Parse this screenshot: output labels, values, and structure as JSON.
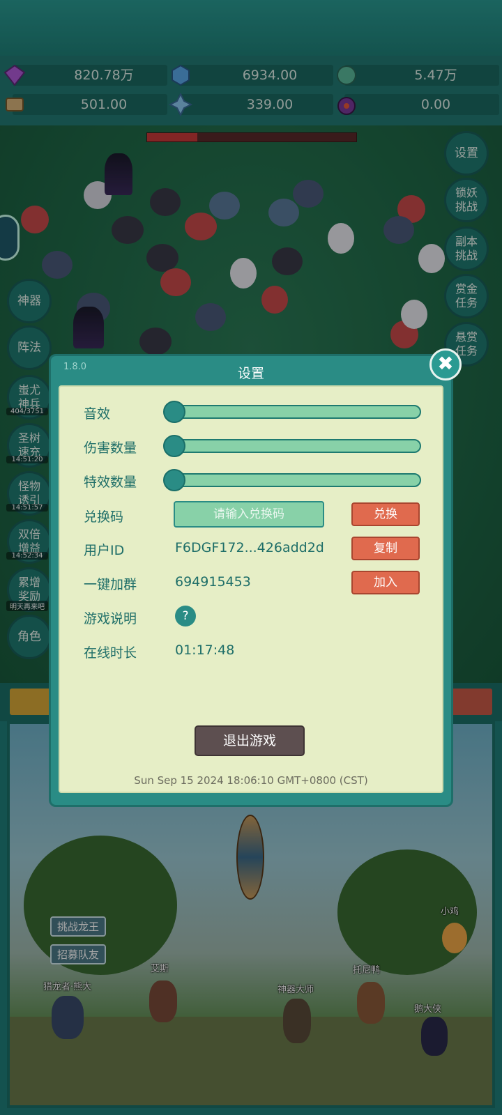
{
  "resources": [
    {
      "icon": "purple-gem-icon",
      "value": "820.78万"
    },
    {
      "icon": "blue-crystal-icon",
      "value": "6934.00"
    },
    {
      "icon": "green-orb-icon",
      "value": "5.47万"
    },
    {
      "icon": "scroll-icon",
      "value": "501.00"
    },
    {
      "icon": "ice-crystal-icon",
      "value": "339.00"
    },
    {
      "icon": "purple-pouch-icon",
      "value": "0.00"
    }
  ],
  "right_menu": [
    {
      "label": "设置"
    },
    {
      "label": "锁妖挑战"
    },
    {
      "label": "副本挑战"
    },
    {
      "label": "赏金任务"
    },
    {
      "label": "悬赏任务"
    }
  ],
  "left_menu": [
    {
      "label": "神器"
    },
    {
      "label": "阵法"
    },
    {
      "label": "蚩尤神兵",
      "sub": "404/3751"
    },
    {
      "label": "圣树速充",
      "sub": "14:51:20"
    },
    {
      "label": "怪物诱引",
      "sub": "14:51:57"
    },
    {
      "label": "双倍增益",
      "sub": "14:52:34"
    },
    {
      "label": "累增奖励",
      "sub": "明天再来吧"
    },
    {
      "label": "角色"
    }
  ],
  "scene": {
    "buttons": [
      "挑战龙王",
      "招募队友"
    ],
    "npcs": [
      "小鸡",
      "艾斯",
      "猎龙者·熊大",
      "托尼鸭",
      "神器大师",
      "鹅大侠"
    ]
  },
  "settings": {
    "version": "1.8.0",
    "title": "设置",
    "sound_label": "音效",
    "sound_level": 0,
    "damage_count_label": "伤害数量",
    "damage_count_level": 0,
    "effects_count_label": "特效数量",
    "effects_count_level": 0,
    "redeem_label": "兑换码",
    "redeem_placeholder": "请输入兑换码",
    "redeem_button": "兑换",
    "user_id_label": "用户ID",
    "user_id_value": "F6DGF172...426add2d",
    "copy_button": "复制",
    "join_group_label": "一键加群",
    "join_group_value": "694915453",
    "join_button": "加入",
    "guide_label": "游戏说明",
    "guide_icon": "?",
    "online_label": "在线时长",
    "online_value": "01:17:48",
    "quit_button": "退出游戏",
    "timestamp": "Sun Sep 15 2024 18:06:10 GMT+0800 (CST)",
    "close_icon": "✖"
  },
  "colors": {
    "accent": "#2a8c85",
    "panel": "#e6eec6",
    "action": "#e06a4e",
    "quit": "#5d4f50"
  }
}
